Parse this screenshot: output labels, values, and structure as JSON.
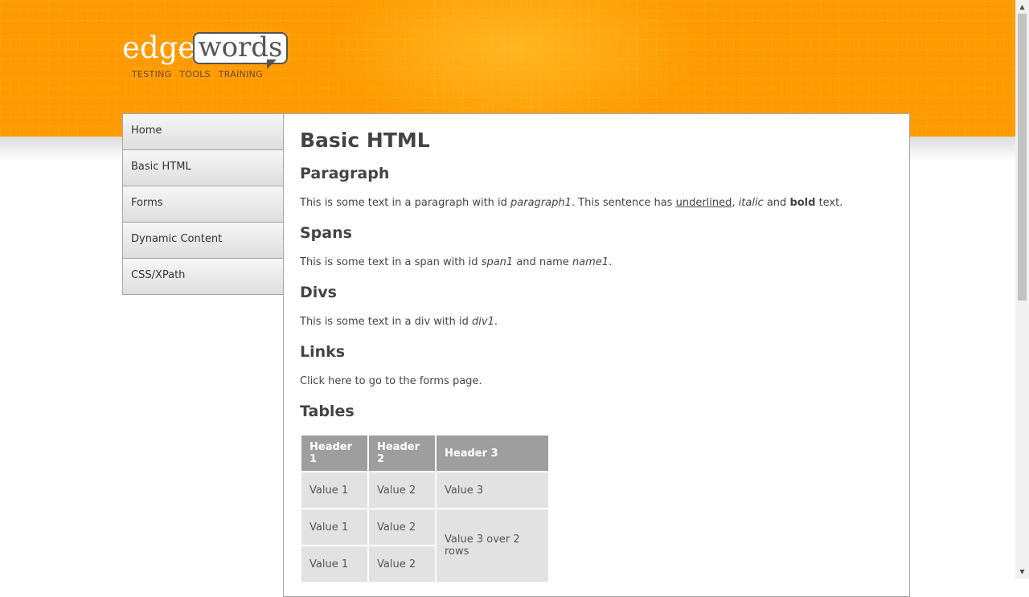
{
  "logo": {
    "edge": "edge",
    "words": "words",
    "tagline": "TESTING   TOOLS   TRAINING"
  },
  "nav": {
    "items": [
      "Home",
      "Basic HTML",
      "Forms",
      "Dynamic Content",
      "CSS/XPath"
    ]
  },
  "page": {
    "title": "Basic HTML"
  },
  "paragraph": {
    "heading": "Paragraph",
    "text1": "This is some text in a paragraph with id ",
    "id": "paragraph1",
    "text2": ". This sentence has ",
    "underlined": "underlined",
    "comma": ", ",
    "italic": "italic",
    "and": " and ",
    "bold": "bold",
    "text3": " text."
  },
  "spans": {
    "heading": "Spans",
    "text1": "This is some text in a span with id ",
    "id": "span1",
    "text2": " and name ",
    "name": "name1",
    "text3": "."
  },
  "divs": {
    "heading": "Divs",
    "text1": "This is some text in a div with id ",
    "id": "div1",
    "text2": "."
  },
  "links": {
    "heading": "Links",
    "click": "Click",
    "here": "here",
    "text": " to go to the forms page."
  },
  "tables": {
    "heading": "Tables",
    "headers": [
      "Header 1",
      "Header 2",
      "Header 3"
    ],
    "row1": [
      "Value 1",
      "Value 2",
      "Value 3"
    ],
    "row2": [
      "Value 1",
      "Value 2",
      "Value 3 over 2 rows"
    ],
    "row3": [
      "Value 1",
      "Value 2"
    ]
  }
}
